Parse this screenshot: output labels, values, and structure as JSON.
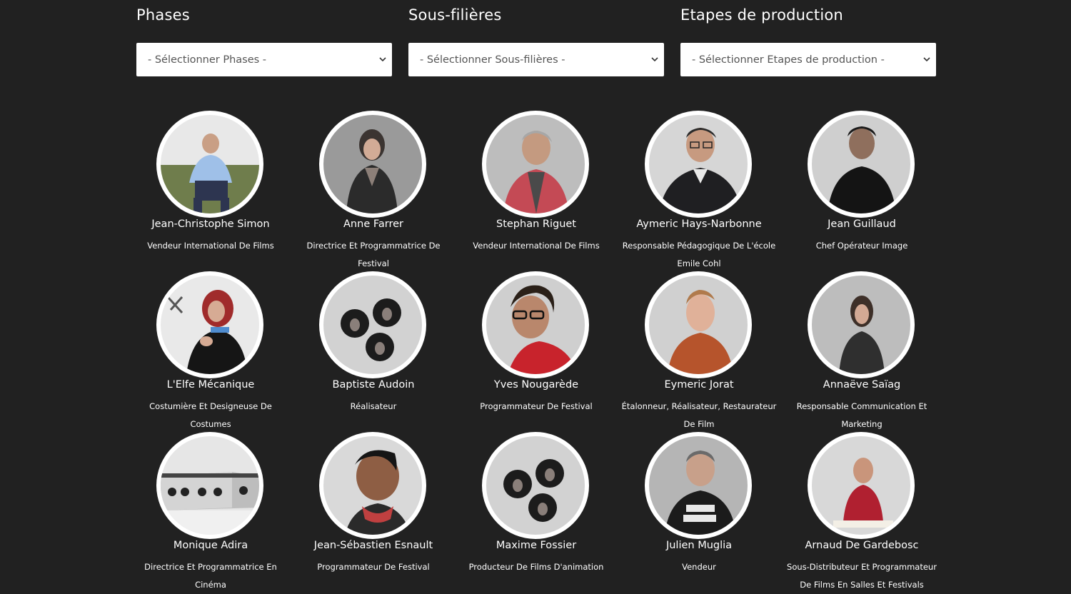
{
  "filters": [
    {
      "label": "Phases",
      "placeholder": "- Sélectionner Phases -"
    },
    {
      "label": "Sous-filières",
      "placeholder": "- Sélectionner Sous-filières -"
    },
    {
      "label": "Etapes de production",
      "placeholder": "- Sélectionner Etapes de production -"
    }
  ],
  "people": [
    {
      "name": "Jean-Christophe Simon",
      "role": "Vendeur International De Films"
    },
    {
      "name": "Anne Farrer",
      "role": "Directrice Et Programmatrice De Festival"
    },
    {
      "name": "Stephan Riguet",
      "role": "Vendeur International De Films"
    },
    {
      "name": "Aymeric Hays-Narbonne",
      "role": "Responsable Pédagogique De L'école Emile Cohl"
    },
    {
      "name": "Jean Guillaud",
      "role": "Chef Opérateur Image"
    },
    {
      "name": "L'Elfe Mécanique",
      "role": "Costumière Et Designeuse De Costumes"
    },
    {
      "name": "Baptiste Audoin",
      "role": "Réalisateur"
    },
    {
      "name": "Yves Nougarède",
      "role": "Programmateur De Festival"
    },
    {
      "name": "Eymeric Jorat",
      "role": "Étalonneur, Réalisateur, Restaurateur De Film"
    },
    {
      "name": "Annaëve Saïag",
      "role": "Responsable Communication Et Marketing"
    },
    {
      "name": "Monique Adira",
      "role": "Directrice Et Programmatrice En Cinéma"
    },
    {
      "name": "Jean-Sébastien Esnault",
      "role": "Programmateur De Festival"
    },
    {
      "name": "Maxime Fossier",
      "role": "Producteur De Films D'animation"
    },
    {
      "name": "Julien Muglia",
      "role": "Vendeur"
    },
    {
      "name": "Arnaud De Gardebosc",
      "role": "Sous-Distributeur Et Programmateur De Films En Salles Et Festivals"
    }
  ]
}
